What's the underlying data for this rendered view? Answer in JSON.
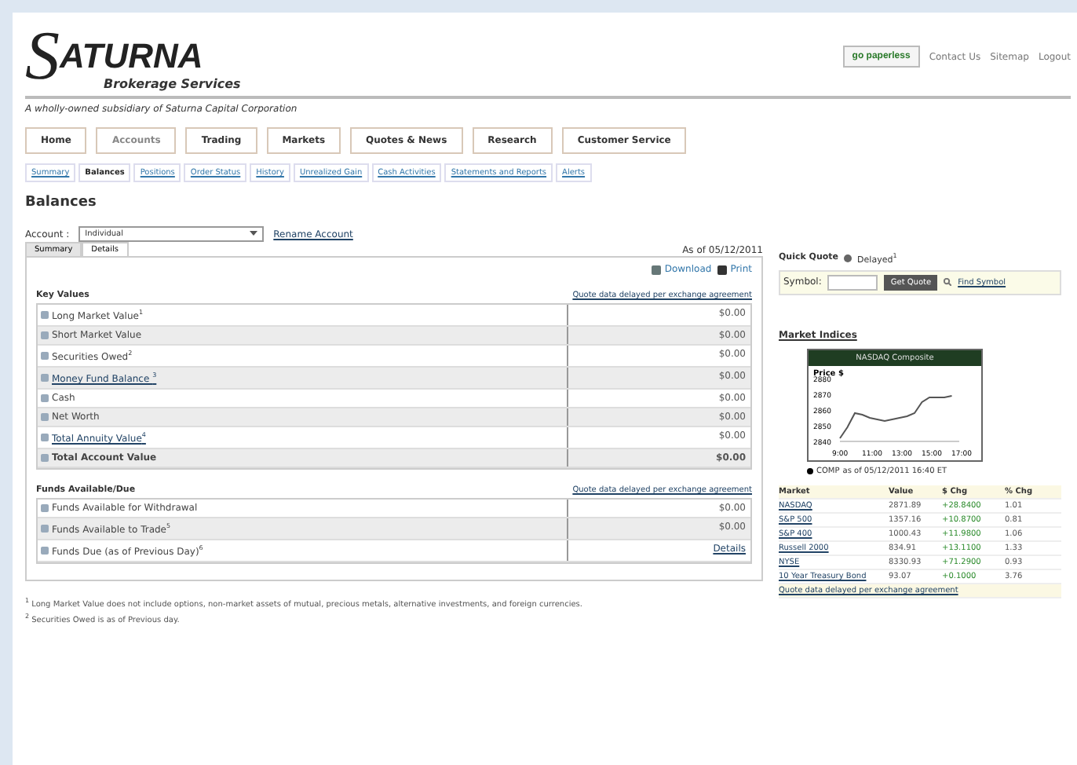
{
  "header": {
    "logo_mark": "S",
    "logo_name": "ATURNA",
    "logo_sub": "Brokerage Services",
    "tagline": "A wholly-owned subsidiary of Saturna Capital Corporation",
    "paperless": "go paperless",
    "links": [
      "Contact Us",
      "Sitemap",
      "Logout"
    ]
  },
  "nav": [
    {
      "label": "Home",
      "selected": false
    },
    {
      "label": "Accounts",
      "selected": true
    },
    {
      "label": "Trading",
      "selected": false
    },
    {
      "label": "Markets",
      "selected": false
    },
    {
      "label": "Quotes & News",
      "selected": false
    },
    {
      "label": "Research",
      "selected": false
    },
    {
      "label": "Customer Service",
      "selected": false
    }
  ],
  "subnav": [
    {
      "label": "Summary",
      "selected": false
    },
    {
      "label": "Balances",
      "selected": true
    },
    {
      "label": "Positions",
      "selected": false
    },
    {
      "label": "Order Status",
      "selected": false
    },
    {
      "label": "History",
      "selected": false
    },
    {
      "label": "Unrealized Gain",
      "selected": false
    },
    {
      "label": "Cash Activities",
      "selected": false
    },
    {
      "label": "Statements and Reports",
      "selected": false
    },
    {
      "label": "Alerts",
      "selected": false
    }
  ],
  "page_title": "Balances",
  "account": {
    "label": "Account :",
    "value": "Individual",
    "link": "Rename Account"
  },
  "tabs": [
    {
      "label": "Summary",
      "selected": true
    },
    {
      "label": "Details",
      "selected": false
    }
  ],
  "as_of": "As of 05/12/2011",
  "actions": [
    "Download",
    "Print"
  ],
  "sections": [
    {
      "title": "Key Values",
      "note": "Quote data delayed per exchange agreement",
      "rows": [
        {
          "label": "Long Market Value$^{1}$",
          "value": "$0.00",
          "link": false,
          "bold": false
        },
        {
          "label": "Short Market Value",
          "value": "$0.00",
          "link": false,
          "bold": false
        },
        {
          "label": "Securities Owed$^{2}$",
          "value": "$0.00",
          "link": false,
          "bold": false
        },
        {
          "label": "Money Fund Balance $^{3}$",
          "value": "$0.00",
          "link": true,
          "bold": false
        },
        {
          "label": "Cash",
          "value": "$0.00",
          "link": false,
          "bold": false
        },
        {
          "label": "Net Worth",
          "value": "$0.00",
          "link": false,
          "bold": false
        },
        {
          "label": "Total Annuity Value$^{4}$",
          "value": "$0.00",
          "link": true,
          "bold": false
        },
        {
          "label": "Total Account Value",
          "value": "$0.00",
          "link": false,
          "bold": true
        }
      ]
    },
    {
      "title": "Funds Available/Due",
      "note": "Quote data delayed per exchange agreement",
      "rows": [
        {
          "label": "Funds Available for Withdrawal",
          "value": "$0.00",
          "link": false,
          "bold": false
        },
        {
          "label": "Funds Available to Trade$^{5}$",
          "value": "$0.00",
          "link": false,
          "bold": false
        },
        {
          "label": "Funds Due (as of Previous Day)$^{6}$",
          "value": "Details",
          "link": false,
          "bold": false,
          "value_link": true
        }
      ]
    }
  ],
  "footnotes": [
    "$^{1}$ Long Market Value does not include options, non-market assets of mutual, precious metals, alternative investments, and foreign currencies.",
    "$^{2}$ Securities Owed is as of Previous day."
  ],
  "quick_quote": {
    "title": "Quick Quote",
    "delayed": "Delayed$^{1}$",
    "symbol_label": "Symbol:",
    "button": "Get Quote",
    "find": "Find Symbol"
  },
  "market_indices": {
    "title": "Market Indices",
    "chart_data": {
      "type": "line",
      "title": "NASDAQ Composite",
      "ylabel": "Price $",
      "x": [
        9,
        9.5,
        10,
        10.5,
        11,
        11.5,
        12,
        12.5,
        13,
        13.5,
        14,
        14.5,
        15,
        15.5,
        16,
        16.5
      ],
      "series": [
        {
          "name": "COMP",
          "color": "#555555",
          "values": [
            2842,
            2849,
            2858,
            2857,
            2855,
            2854,
            2853,
            2854,
            2855,
            2856,
            2858,
            2865,
            2868,
            2868,
            2868,
            2869
          ]
        }
      ],
      "xlim": [
        9,
        17
      ],
      "ylim": [
        2840,
        2880
      ],
      "yticks": [
        2840,
        2850,
        2860,
        2870,
        2880
      ],
      "xticks": [
        {
          "value": 9,
          "label": "9:00"
        },
        {
          "value": 11,
          "label": "11:00"
        },
        {
          "value": 13,
          "label": "13:00"
        },
        {
          "value": 15,
          "label": "15:00"
        },
        {
          "value": 17,
          "label": "17:00"
        }
      ]
    },
    "caption": "as of 05/12/2011 16:40 ET",
    "columns": [
      "Market",
      "Value",
      "$ Chg",
      "% Chg"
    ],
    "rows": [
      [
        "NASDAQ",
        "2871.89",
        "+28.8400",
        "1.01"
      ],
      [
        "S&P 500",
        "1357.16",
        "+10.8700",
        "0.81"
      ],
      [
        "S&P 400",
        "1000.43",
        "+11.9800",
        "1.06"
      ],
      [
        "Russell 2000",
        "834.91",
        "+13.1100",
        "1.33"
      ],
      [
        "NYSE",
        "8330.93",
        "+71.2900",
        "0.93"
      ],
      [
        "10 Year Treasury Bond",
        "93.07",
        "+0.1000",
        "3.76"
      ]
    ],
    "footer_link": "Quote data delayed per exchange agreement"
  }
}
